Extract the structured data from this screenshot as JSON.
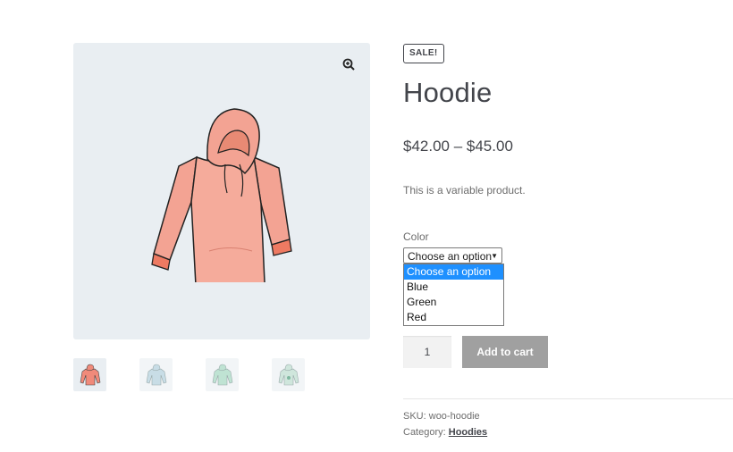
{
  "product": {
    "sale_badge": "SALE!",
    "title": "Hoodie",
    "price": "$42.00 – $45.00",
    "description": "This is a variable product.",
    "color_label": "Color",
    "color_select_value": "Choose an option",
    "color_options": [
      "Choose an option",
      "Blue",
      "Green",
      "Red"
    ],
    "quantity": "1",
    "add_to_cart_label": "Add to cart",
    "sku_label": "SKU:",
    "sku_value": "woo-hoodie",
    "category_label": "Category:",
    "category_value": "Hoodies"
  },
  "gallery": {
    "zoom_icon": "zoom-in-icon",
    "thumbnails": [
      {
        "name": "hoodie-red",
        "color": "#f08a7a"
      },
      {
        "name": "hoodie-blue",
        "color": "#c8dde6"
      },
      {
        "name": "hoodie-green",
        "color": "#bfe3d3"
      },
      {
        "name": "hoodie-green-logo",
        "color": "#cfe6dc"
      }
    ]
  },
  "colors": {
    "dropdown_highlight": "#1e90ff",
    "button_bg": "#a0a0a0",
    "gallery_bg": "#e9eef2"
  }
}
